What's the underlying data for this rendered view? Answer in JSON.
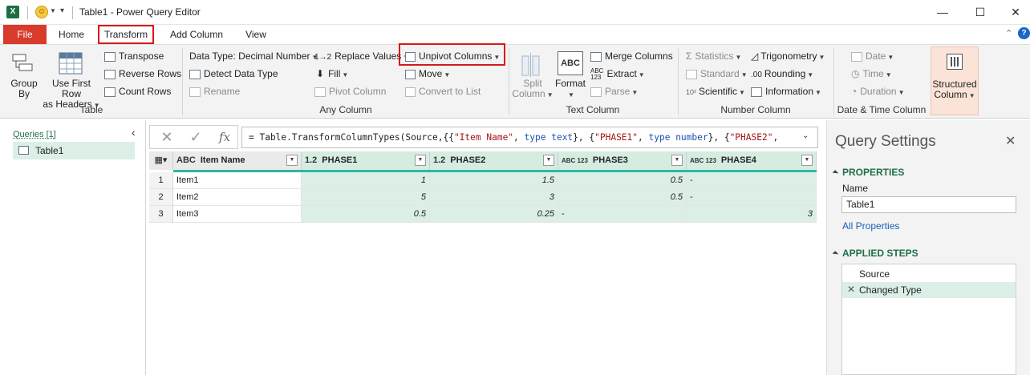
{
  "window": {
    "title": "Table1 - Power Query Editor",
    "logo_letter": "X",
    "min_glyph": "—",
    "max_glyph": "☐",
    "close_glyph": "✕"
  },
  "tabs": [
    {
      "label": "File"
    },
    {
      "label": "Home"
    },
    {
      "label": "Transform"
    },
    {
      "label": "Add Column"
    },
    {
      "label": "View"
    }
  ],
  "ribbon": {
    "table": {
      "label": "Table",
      "group_by": [
        "Group",
        "By"
      ],
      "first_row": [
        "Use First Row",
        "as Headers"
      ],
      "transpose": "Transpose",
      "reverse_rows": "Reverse Rows",
      "count_rows": "Count Rows"
    },
    "any_column": {
      "label": "Any Column",
      "data_type": "Data Type: Decimal Number",
      "detect_type": "Detect Data Type",
      "rename": "Rename",
      "replace_values": "Replace Values",
      "fill": "Fill",
      "pivot_column": "Pivot Column",
      "unpivot_columns": "Unpivot Columns",
      "move": "Move",
      "convert_to_list": "Convert to List"
    },
    "text_column": {
      "label": "Text Column",
      "split_column": [
        "Split",
        "Column"
      ],
      "format": "Format",
      "merge_columns": "Merge Columns",
      "extract": "Extract",
      "parse": "Parse"
    },
    "number_column": {
      "label": "Number Column",
      "statistics": "Statistics",
      "standard": "Standard",
      "scientific": "Scientific",
      "trigonometry": "Trigonometry",
      "rounding": "Rounding",
      "information": "Information"
    },
    "datetime_column": {
      "label": "Date & Time Column",
      "date": "Date",
      "time": "Time",
      "duration": "Duration"
    },
    "structured": {
      "label": [
        "Structured",
        "Column"
      ]
    }
  },
  "queries": {
    "header": "Queries [1]",
    "items": [
      "Table1"
    ]
  },
  "formula": {
    "prefix": "= Table.TransformColumnTypes(Source,{{",
    "s1": "\"Item Name\"",
    "t1": "type text",
    "mid1": "}, {",
    "s2": "\"PHASE1\"",
    "t2": "type number",
    "mid2": "}, {",
    "s3": "\"PHASE2\"",
    "comma": ","
  },
  "grid": {
    "columns": [
      {
        "type": "ABC",
        "name": "Item Name"
      },
      {
        "type": "1.2",
        "name": "PHASE1"
      },
      {
        "type": "1.2",
        "name": "PHASE2"
      },
      {
        "type": "ABC 123",
        "name": "PHASE3"
      },
      {
        "type": "ABC 123",
        "name": "PHASE4"
      }
    ],
    "rows": [
      {
        "n": "1",
        "cells": [
          "Item1",
          "1",
          "1.5",
          "0.5",
          "-"
        ]
      },
      {
        "n": "2",
        "cells": [
          "Item2",
          "5",
          "3",
          "0.5",
          "-"
        ]
      },
      {
        "n": "3",
        "cells": [
          "Item3",
          "0.5",
          "0.25",
          "-",
          "3"
        ]
      }
    ]
  },
  "settings": {
    "title": "Query Settings",
    "properties": "PROPERTIES",
    "name_label": "Name",
    "name_value": "Table1",
    "all_properties": "All Properties",
    "applied_steps": "APPLIED STEPS",
    "steps": [
      "Source",
      "Changed Type"
    ]
  }
}
